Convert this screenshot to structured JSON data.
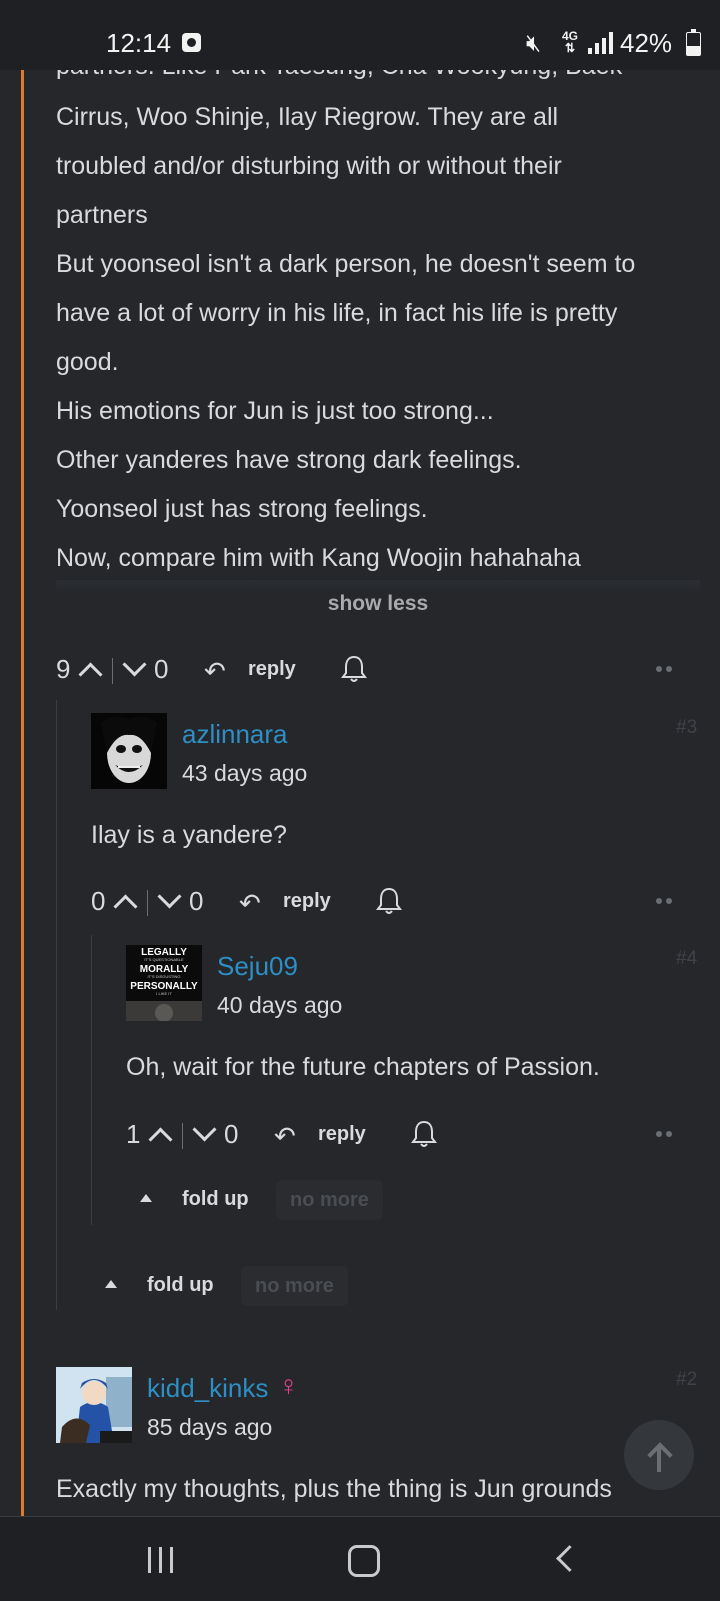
{
  "status_bar": {
    "time": "12:14",
    "network": "4G",
    "battery": "42%",
    "battery_level": 0.42
  },
  "comment_top": {
    "text_cut_line": "partners. Like Park Taesung, Cha Wookyung, Baek",
    "lines": [
      "Cirrus, Woo Shinje, Ilay Riegrow. They are all",
      "troubled and/or disturbing with or without their",
      "partners",
      "But yoonseol isn't a dark person, he doesn't seem to",
      "have a lot of worry in his life, in fact his life is pretty",
      "good.",
      "His emotions for Jun is just too strong...",
      "Other yanderes have strong dark feelings.",
      "Yoonseol just has strong feelings.",
      "Now, compare him with Kang Woojin hahahaha"
    ],
    "show_less": "show less",
    "upvotes": "9",
    "downvotes": "0",
    "reply": "reply"
  },
  "reply_1": {
    "username": "azlinnara",
    "date": "43 days ago",
    "number": "#3",
    "text": "Ilay is a yandere?",
    "upvotes": "0",
    "downvotes": "0",
    "reply": "reply",
    "fold_up": "fold up",
    "no_more": "no more"
  },
  "reply_2": {
    "username": "Seju09",
    "date": "40 days ago",
    "number": "#4",
    "text": "Oh, wait for the future chapters of Passion.",
    "upvotes": "1",
    "downvotes": "0",
    "reply": "reply",
    "fold_up": "fold up",
    "no_more": "no more",
    "avatar_text": [
      "LEGALLY",
      "IT'S QUESTIONABLE",
      "MORALLY",
      "IT'S DISGUSTING",
      "PERSONALLY",
      "I LIKE IT"
    ]
  },
  "comment_next": {
    "username": "kidd_kinks",
    "gender_symbol": "♀",
    "date": "85 days ago",
    "number": "#2",
    "text": "Exactly my thoughts, plus the thing is Jun grounds"
  },
  "colors": {
    "background": "#25272b",
    "thread_accent": "#e07a2f",
    "username": "#2d8fc4",
    "female": "#e0458a"
  }
}
